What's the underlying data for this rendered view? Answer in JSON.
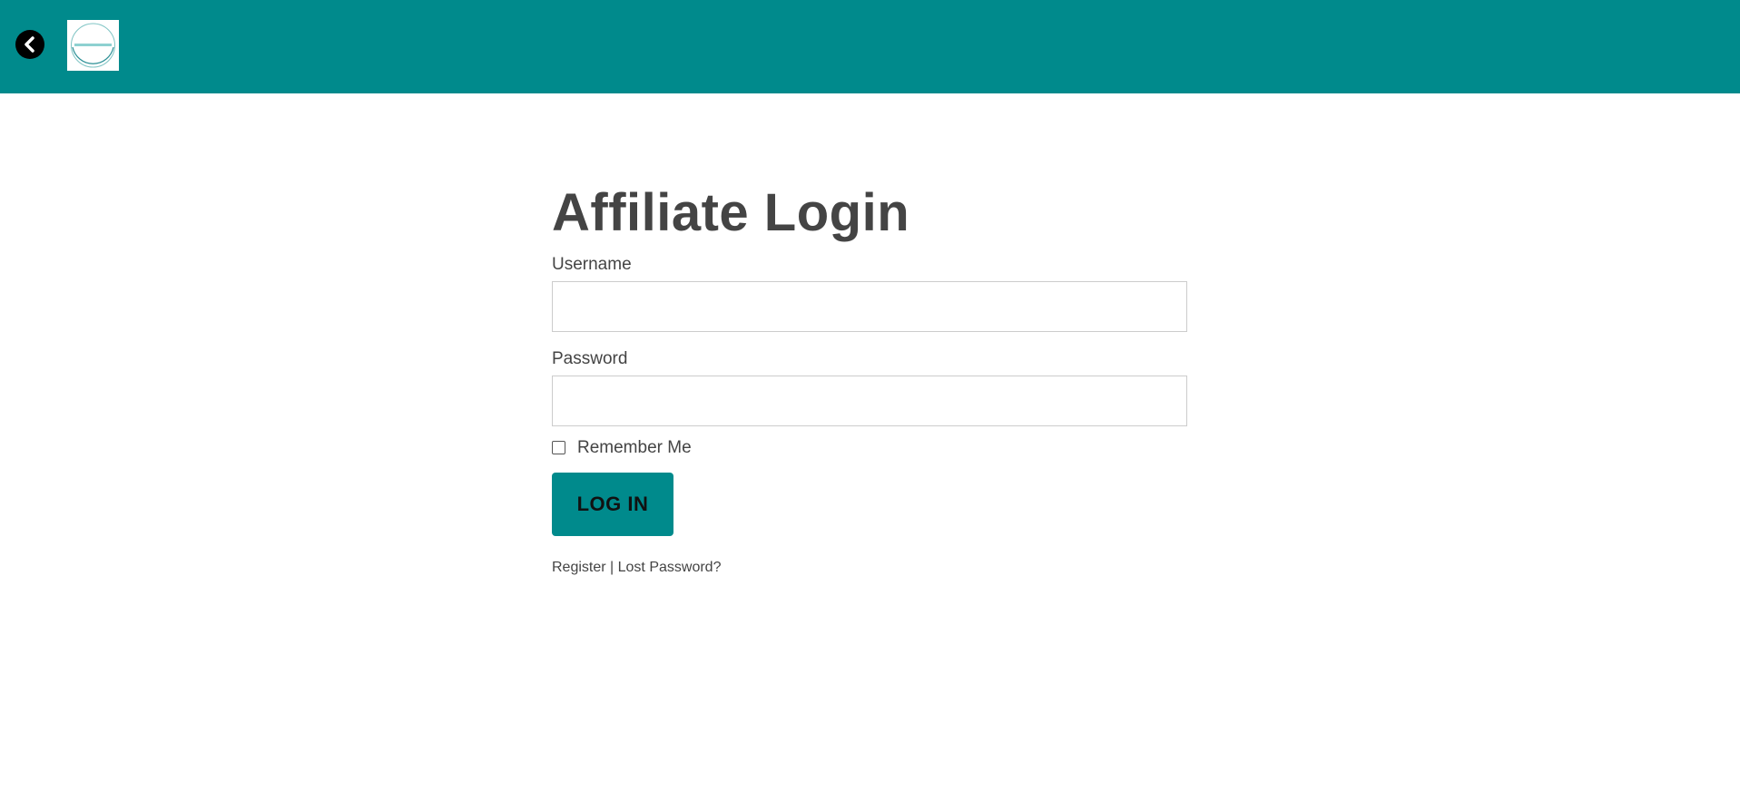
{
  "header": {
    "background_color": "#008a8c",
    "back_icon": "chevron-left-circle-icon",
    "logo_icon": "site-logo"
  },
  "form": {
    "title": "Affiliate Login",
    "username_label": "Username",
    "username_value": "",
    "password_label": "Password",
    "password_value": "",
    "remember_label": "Remember Me",
    "remember_checked": false,
    "submit_label": "LOG IN",
    "accent_color": "#008a8c"
  },
  "links": {
    "register": "Register",
    "separator": " | ",
    "lost_password": "Lost Password?"
  }
}
